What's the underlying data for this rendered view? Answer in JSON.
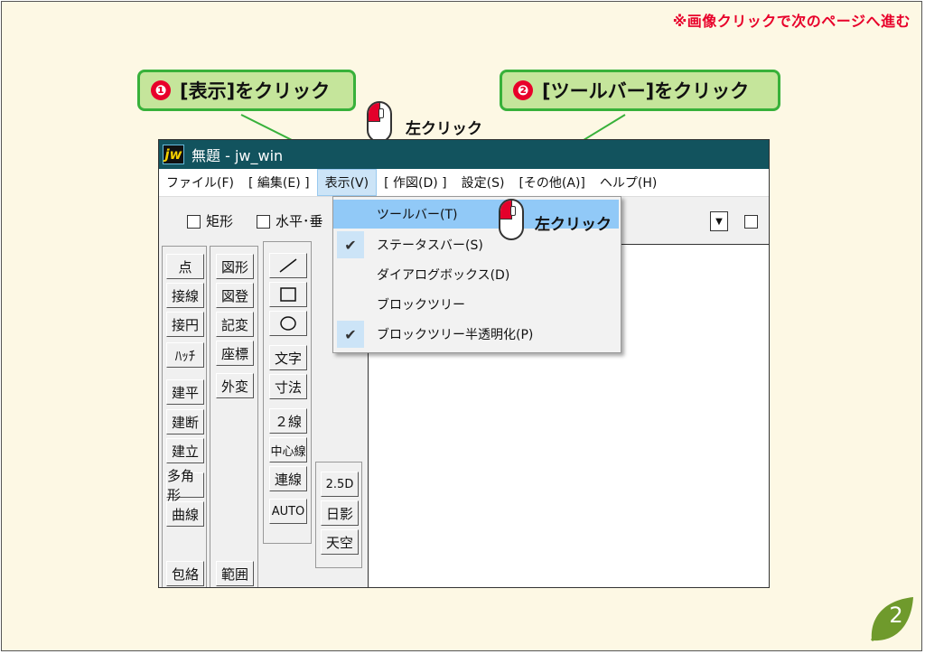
{
  "header": {
    "note": "※画像クリックで次のページへ進む"
  },
  "callouts": [
    {
      "number": "❶",
      "text": "[表示]をクリック"
    },
    {
      "number": "❷",
      "text": "[ツールバー]をクリック"
    }
  ],
  "mouse_hints": [
    "左クリック",
    "左クリック"
  ],
  "window": {
    "icon_text": "jw",
    "title": "無題 - jw_win"
  },
  "menubar": [
    "ファイル(F)",
    "[ 編集(E) ]",
    "表示(V)",
    "[ 作図(D) ]",
    "設定(S)",
    "[その他(A)]",
    "ヘルプ(H)"
  ],
  "toolrow": {
    "check1": "矩形",
    "check2": "水平･垂"
  },
  "dropdown": {
    "items": [
      {
        "label": "ツールバー(T)",
        "checked": false
      },
      {
        "label": "ステータスバー(S)",
        "checked": true
      },
      {
        "label": "ダイアログボックス(D)",
        "checked": false
      },
      {
        "label": "ブロックツリー",
        "checked": false
      },
      {
        "label": "ブロックツリー半透明化(P)",
        "checked": true
      }
    ]
  },
  "tool_col1": [
    "点",
    "接線",
    "接円",
    "ﾊｯﾁ",
    "建平",
    "建断",
    "建立",
    "多角形",
    "曲線",
    "包絡"
  ],
  "tool_col2": [
    "図形",
    "図登",
    "記変",
    "座標",
    "外変",
    "範囲"
  ],
  "tool_col3": [
    "文字",
    "寸法",
    "２線",
    "中心線",
    "連線",
    "AUTO"
  ],
  "tool_col4": [
    "2.5D",
    "日影",
    "天空"
  ],
  "page_number": "2",
  "colors": {
    "callout_fill": "#c5e59b",
    "callout_border": "#38b13a",
    "accent_red": "#e8002a",
    "titlebar": "#12535e"
  }
}
